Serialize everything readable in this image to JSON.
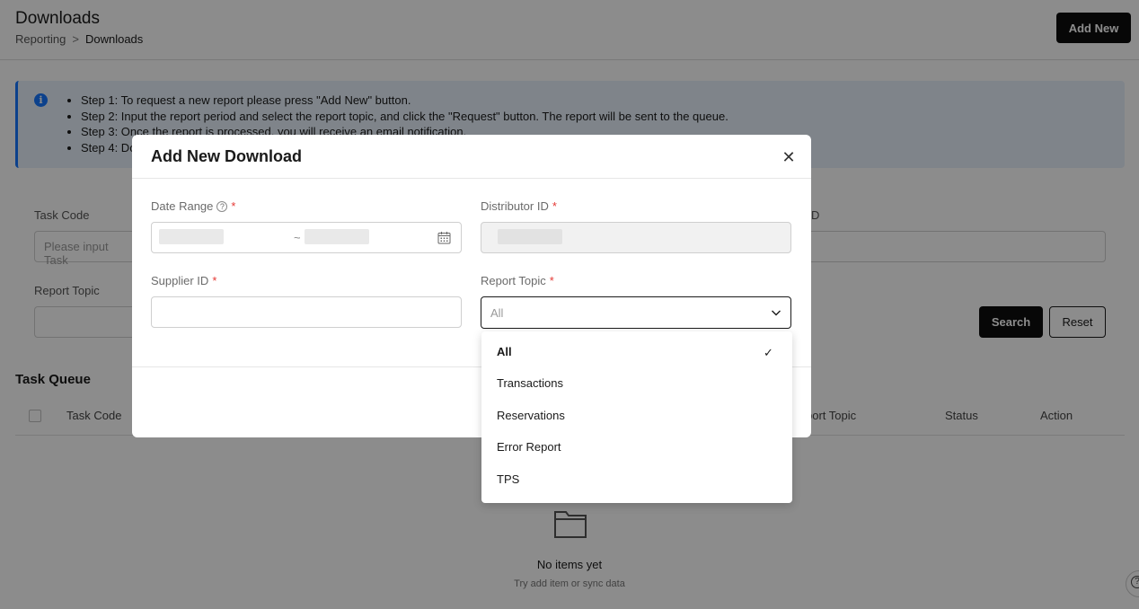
{
  "header": {
    "title": "Downloads",
    "breadcrumb": [
      "Reporting",
      ">",
      "Downloads"
    ],
    "add_new_label": "Add New"
  },
  "info": {
    "steps": [
      "Step 1: To request a new report please press \"Add New\" button.",
      "Step 2: Input the report period and select the report topic, and click the \"Request\" button. The report will be sent to the queue.",
      "Step 3: Once the report is processed, you will receive an email notification.",
      "Step 4: Do"
    ]
  },
  "filters": {
    "task_code_label": "Task Code",
    "task_code_placeholder": "Please input Task",
    "report_topic_label": "Report Topic",
    "right_label_fragment": "D",
    "search_label": "Search",
    "reset_label": "Reset"
  },
  "task_queue": {
    "title": "Task Queue",
    "columns": [
      "Task Code",
      "port Topic",
      "Status",
      "Action"
    ],
    "empty_title": "No items yet",
    "empty_subtitle": "Try add item or sync data"
  },
  "modal": {
    "title": "Add New Download",
    "date_range_label": "Date Range",
    "date_separator": "~",
    "distributor_label": "Distributor ID",
    "supplier_label": "Supplier ID",
    "report_topic_label": "Report Topic",
    "report_topic_value": "All",
    "required_mark": "*",
    "report_topic_options": [
      "All",
      "Transactions",
      "Reservations",
      "Error Report",
      "TPS"
    ],
    "selected_option": "All"
  },
  "colors": {
    "primary_dark": "#0e0e0e",
    "info_blue": "#1677ff",
    "info_bg": "#e7f1fb",
    "required_red": "#e53935"
  }
}
